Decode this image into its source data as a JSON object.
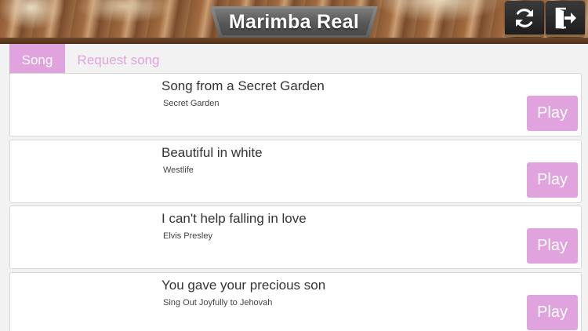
{
  "app": {
    "title": "Marimba Real"
  },
  "header": {
    "refresh_icon": "refresh-icon",
    "logout_icon": "exit-icon"
  },
  "tabs": [
    {
      "label": "Song",
      "active": true
    },
    {
      "label": "Request song",
      "active": false
    }
  ],
  "songs": [
    {
      "title": "Song from a Secret Garden",
      "artist": "Secret Garden",
      "play_label": "Play"
    },
    {
      "title": "Beautiful in white",
      "artist": "Westlife",
      "play_label": "Play"
    },
    {
      "title": "I can't help falling in love",
      "artist": "Elvis Presley",
      "play_label": "Play"
    },
    {
      "title": "You gave your precious son",
      "artist": "Sing Out Joyfully to Jehovah",
      "play_label": "Play"
    }
  ],
  "colors": {
    "accent": "#e1a3de",
    "background": "#f2f2f2"
  }
}
